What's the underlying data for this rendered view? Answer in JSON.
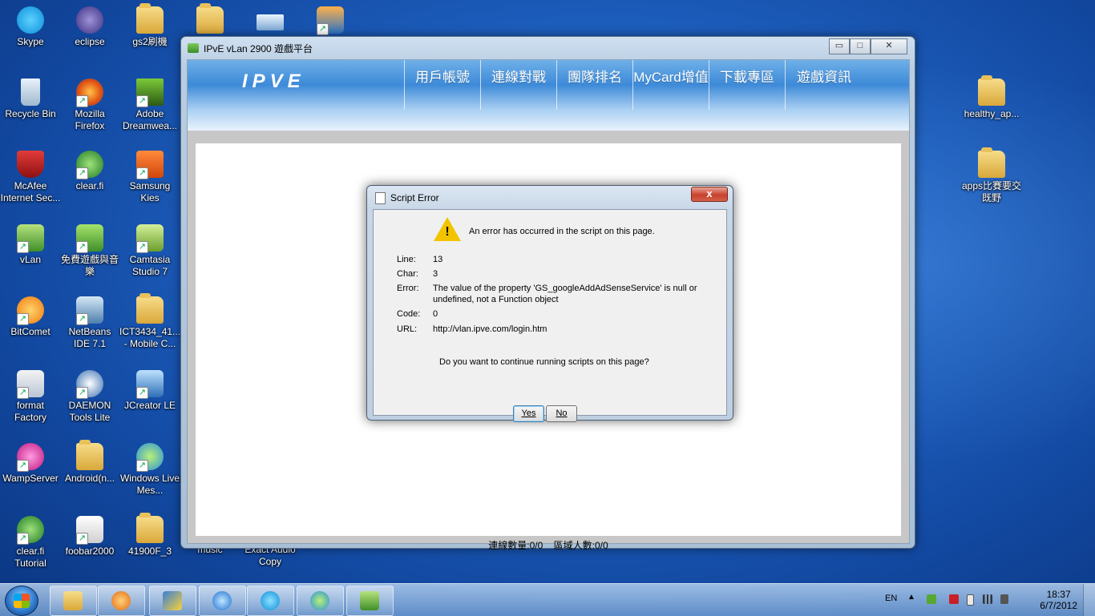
{
  "desktop": {
    "icons_col1": [
      "Skype",
      "Recycle Bin",
      "McAfee Internet Sec...",
      "vLan",
      "BitComet",
      "format Factory",
      "WampServer",
      "clear.fi Tutorial"
    ],
    "icons_col2": [
      "eclipse",
      "Mozilla Firefox",
      "clear.fi",
      "免費遊戲與音樂",
      "NetBeans IDE 7.1",
      "DAEMON Tools Lite",
      "Android(n...",
      "foobar2000"
    ],
    "icons_col3": [
      "gs2刷機",
      "Adobe Dreamwea...",
      "Samsung Kies",
      "Camtasia Studio 7",
      "ICT3434_41... - Mobile C...",
      "JCreator LE",
      "Windows Live Mes...",
      "41900F_3"
    ],
    "icons_bottom": [
      "music",
      "Exact Audio Copy"
    ],
    "icons_right": [
      "healthy_ap...",
      "apps比賽要交既野"
    ]
  },
  "window": {
    "title": "IPvE vLan 2900 遊戲平台",
    "logo": "IPVE",
    "nav": [
      "用戶帳號",
      "連線對戰",
      "團隊排名",
      "MyCard增值",
      "下載專區",
      "遊戲資訊"
    ],
    "status_connections": "連線數量:0/0",
    "status_people": "區域人數:0/0",
    "controls": {
      "minimize": "▭",
      "maximize": "□",
      "close": "✕"
    }
  },
  "dialog": {
    "title": "Script Error",
    "close": "x",
    "heading": "An error has occurred in the script on this page.",
    "line_label": "Line:",
    "line_value": "13",
    "char_label": "Char:",
    "char_value": "3",
    "error_label": "Error:",
    "error_value_1": "The value of the property 'GS_googleAddAdSenseService' is null or",
    "error_value_2": "undefined, not a Function object",
    "code_label": "Code:",
    "code_value": "0",
    "url_label": "URL:",
    "url_value": "http://vlan.ipve.com/login.htm",
    "question": "Do you want to continue running scripts on this page?",
    "yes": "Yes",
    "no": "No"
  },
  "taskbar": {
    "language": "EN",
    "time": "18:37",
    "date": "6/7/2012"
  }
}
